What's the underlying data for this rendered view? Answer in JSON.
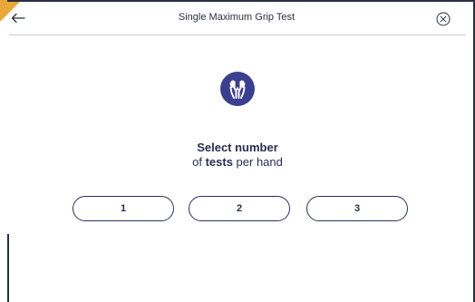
{
  "header": {
    "title": "Single Maximum Grip Test",
    "back_icon": "arrow-left-icon",
    "close_icon": "circle-x-icon"
  },
  "hero": {
    "icon": "raised-hands-icon"
  },
  "prompt": {
    "line1": "Select number",
    "line2_prefix": "of ",
    "line2_bold": "tests",
    "line2_suffix": " per hand"
  },
  "options": [
    {
      "label": "1"
    },
    {
      "label": "2"
    },
    {
      "label": "3"
    }
  ],
  "colors": {
    "accent": "#3b3f8f",
    "text": "#2a2d52",
    "corner": "#e8a93a",
    "frame": "#2b2f45"
  }
}
